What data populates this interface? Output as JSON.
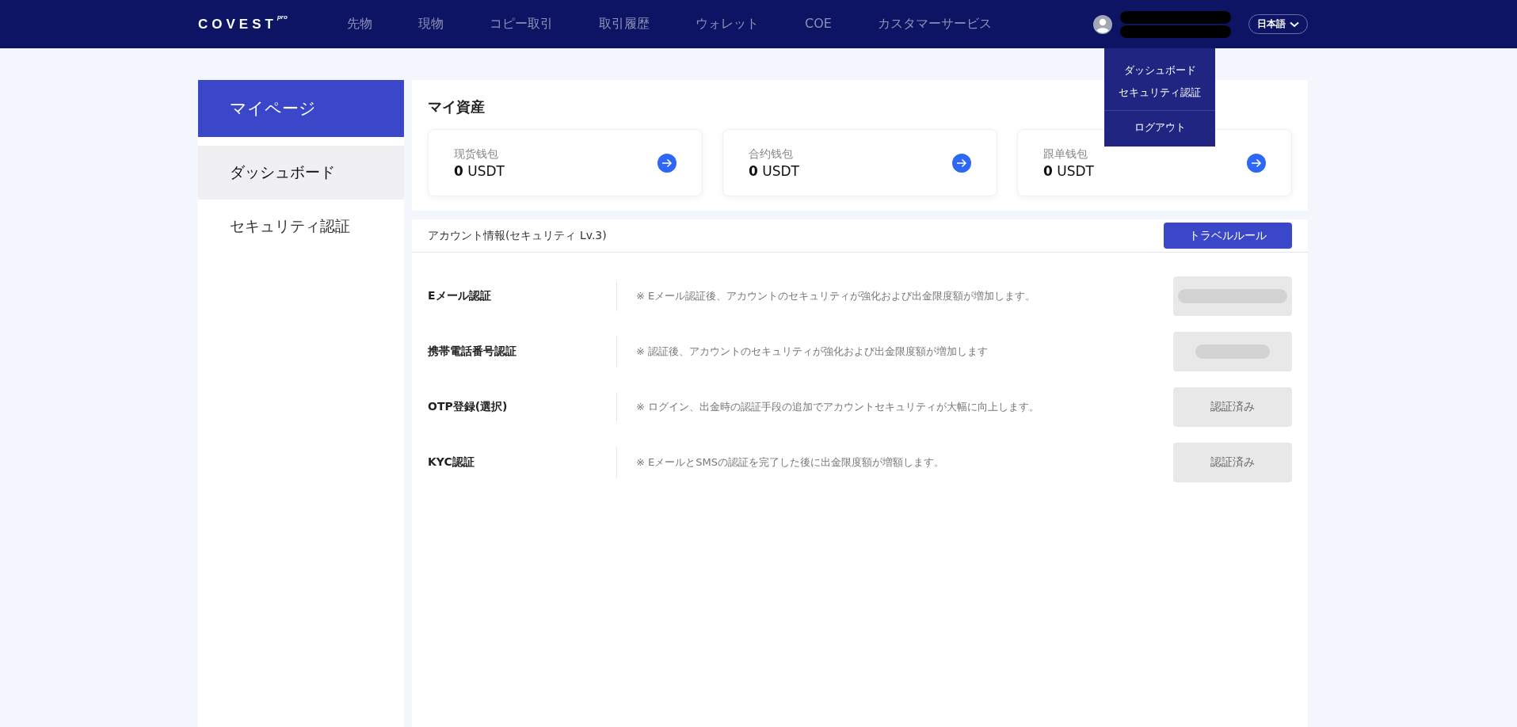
{
  "header": {
    "logo": "COVEST",
    "logo_sup": "pro",
    "nav": [
      {
        "label": "先物"
      },
      {
        "label": "現物"
      },
      {
        "label": "コピー取引"
      },
      {
        "label": "取引履歴"
      },
      {
        "label": "ウォレット"
      },
      {
        "label": "COE"
      },
      {
        "label": "カスタマーサービス"
      }
    ],
    "language": "日本語"
  },
  "user_menu": {
    "items": [
      {
        "label": "ダッシュボード",
        "kind": "link"
      },
      {
        "label": "セキュリティ認証",
        "kind": "link"
      },
      {
        "label": "ログアウト",
        "kind": "logout"
      }
    ]
  },
  "sidebar": {
    "title": "マイページ",
    "items": [
      {
        "label": "ダッシュボード",
        "selected": true
      },
      {
        "label": "セキュリティ認証",
        "selected": false
      }
    ]
  },
  "assets": {
    "title": "マイ資産",
    "wallets": [
      {
        "name": "现货钱包",
        "amount": "0",
        "unit": "USDT"
      },
      {
        "name": "合约钱包",
        "amount": "0",
        "unit": "USDT"
      },
      {
        "name": "跟单钱包",
        "amount": "0",
        "unit": "USDT"
      }
    ]
  },
  "account": {
    "title": "アカウント情報(セキュリティ Lv.3)",
    "button": "トラベルルール",
    "rows": [
      {
        "label": "Eメール認証",
        "note": "※ Eメール認証後、アカウントのセキュリティが強化および出金限度額が増加します。",
        "action": {
          "kind": "redacted"
        }
      },
      {
        "label": "携帯電話番号認証",
        "note": "※ 認証後、アカウントのセキュリティが強化および出金限度額が増加します",
        "action": {
          "kind": "redacted-short"
        }
      },
      {
        "label": "OTP登録(選択)",
        "note": "※ ログイン、出金時の認証手段の追加でアカウントセキュリティが大幅に向上します。",
        "action": {
          "kind": "text",
          "label": "認証済み"
        }
      },
      {
        "label": "KYC認証",
        "note": "※ EメールとSMSの認証を完了した後に出金限度額が増額します。",
        "action": {
          "kind": "text",
          "label": "認証済み"
        }
      }
    ]
  }
}
